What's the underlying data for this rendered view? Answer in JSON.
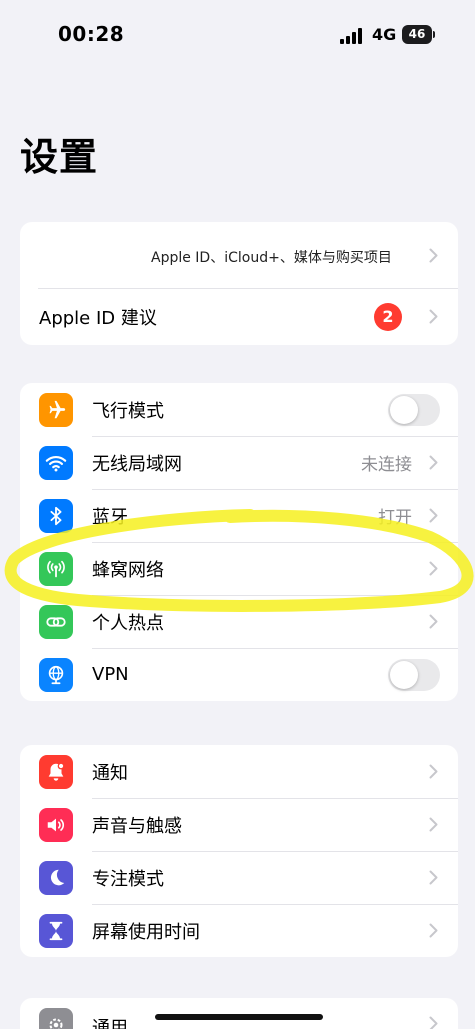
{
  "status": {
    "time": "00:28",
    "network": "4G",
    "battery": "46"
  },
  "page": {
    "title": "设置"
  },
  "account": {
    "subtitle": "Apple ID、iCloud+、媒体与购买项目",
    "suggestion_label": "Apple ID 建议",
    "suggestion_badge": "2"
  },
  "connectivity": {
    "airplane": {
      "label": "飞行模式",
      "icon": "airplane-icon",
      "color": "#ff9500",
      "enabled": false
    },
    "wifi": {
      "label": "无线局域网",
      "value": "未连接",
      "icon": "wifi-icon",
      "color": "#007aff"
    },
    "bluetooth": {
      "label": "蓝牙",
      "value": "打开",
      "icon": "bluetooth-icon",
      "color": "#007aff"
    },
    "cellular": {
      "label": "蜂窝网络",
      "icon": "cellular-antenna-icon",
      "color": "#34c759"
    },
    "hotspot": {
      "label": "个人热点",
      "icon": "hotspot-link-icon",
      "color": "#34c759"
    },
    "vpn": {
      "label": "VPN",
      "icon": "globe-icon",
      "color": "#0a84ff",
      "enabled": false
    }
  },
  "notifications_group": {
    "notifications": {
      "label": "通知",
      "icon": "bell-icon",
      "color": "#ff3b30"
    },
    "sounds": {
      "label": "声音与触感",
      "icon": "speaker-icon",
      "color": "#ff2d55"
    },
    "focus": {
      "label": "专注模式",
      "icon": "moon-icon",
      "color": "#5856d6"
    },
    "screen_time": {
      "label": "屏幕使用时间",
      "icon": "hourglass-icon",
      "color": "#5856d6"
    }
  },
  "general_group": {
    "general": {
      "label": "通用",
      "icon": "gear-icon",
      "color": "#8e8e93"
    }
  },
  "annotation": {
    "color": "#f6f01e"
  }
}
